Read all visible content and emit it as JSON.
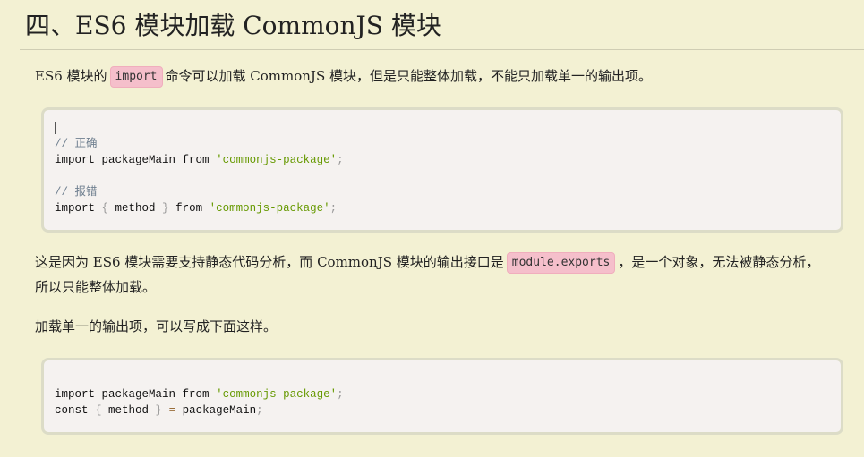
{
  "heading": "四、ES6 模块加载 CommonJS 模块",
  "intro": {
    "before": "ES6 模块的",
    "code": "import",
    "after": "命令可以加载 CommonJS 模块，但是只能整体加载，不能只加载单一的输出项。"
  },
  "code_block_1": {
    "comment_ok": "// 正确",
    "line2_import": "import",
    "line2_name": " packageMain ",
    "line2_from": "from",
    "line2_string": "'commonjs-package'",
    "line2_semicolon": ";",
    "comment_err": "// 报错",
    "line4_import": "import",
    "line4_open": " { ",
    "line4_name": "method",
    "line4_close": " } ",
    "line4_from": "from",
    "line4_string": "'commonjs-package'",
    "line4_semicolon": ";"
  },
  "explain": {
    "before": "这是因为 ES6 模块需要支持静态代码分析，而 CommonJS 模块的输出接口是",
    "code": "module.exports",
    "after": "，是一个对象，无法被静态分析，",
    "line2": "所以只能整体加载。"
  },
  "single_output": "加载单一的输出项，可以写成下面这样。",
  "code_block_2": {
    "line1_import": "import",
    "line1_name": " packageMain ",
    "line1_from": "from",
    "line1_string": "'commonjs-package'",
    "line1_semicolon": ";",
    "line2_const": "const",
    "line2_open": " { ",
    "line2_name": "method",
    "line2_close": " } ",
    "line2_eq": "=",
    "line2_value": " packageMain",
    "line2_semicolon": ";"
  }
}
